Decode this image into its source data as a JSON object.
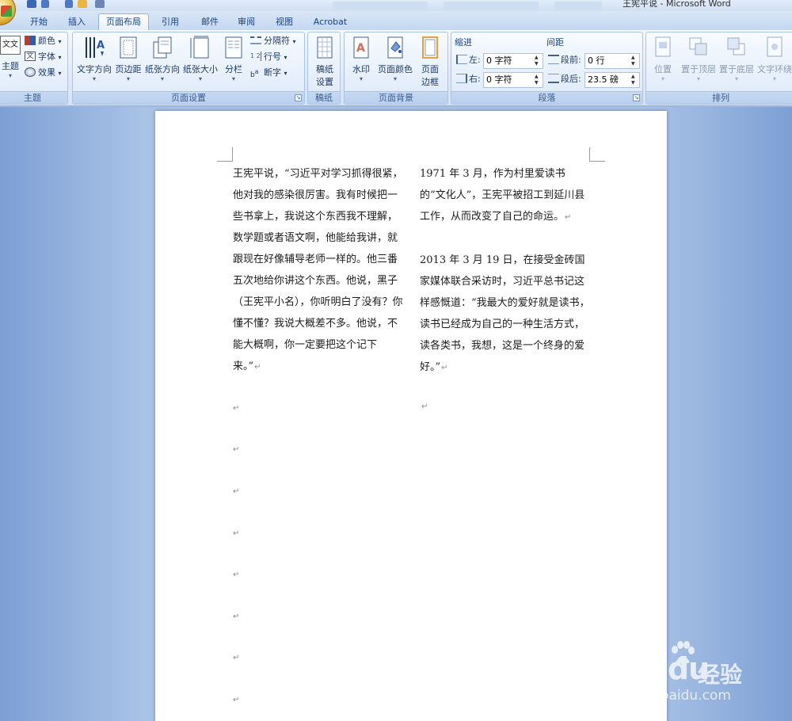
{
  "window": {
    "title": "王宪平说 - Microsoft Word"
  },
  "tabs": [
    {
      "label": "开始"
    },
    {
      "label": "插入"
    },
    {
      "label": "页面布局",
      "active": true
    },
    {
      "label": "引用"
    },
    {
      "label": "邮件"
    },
    {
      "label": "审阅"
    },
    {
      "label": "视图"
    },
    {
      "label": "Acrobat"
    }
  ],
  "ribbon": {
    "themes": {
      "label": "主题",
      "theme_button": "主题",
      "colors": "颜色",
      "fonts": "字体",
      "effects": "效果"
    },
    "page_setup": {
      "label": "页面设置",
      "text_direction": "文字方向",
      "margins": "页边距",
      "orientation": "纸张方向",
      "size": "纸张大小",
      "columns": "分栏",
      "breaks": "分隔符",
      "line_numbers": "行号",
      "hyphenation": "断字"
    },
    "manuscript": {
      "label": "稿纸",
      "settings_line1": "稿纸",
      "settings_line2": "设置"
    },
    "page_background": {
      "label": "页面背景",
      "watermark": "水印",
      "page_color": "页面颜色",
      "page_borders_line1": "页面",
      "page_borders_line2": "边框"
    },
    "paragraph": {
      "label": "段落",
      "indent_label": "缩进",
      "spacing_label": "间距",
      "left_label": "左:",
      "left_value": "0 字符",
      "right_label": "右:",
      "right_value": "0 字符",
      "before_label": "段前:",
      "before_value": "0 行",
      "after_label": "段后:",
      "after_value": "23.5 磅"
    },
    "arrange": {
      "label": "排列",
      "position": "位置",
      "bring_to_front": "置于顶层",
      "send_to_back": "置于底层",
      "text_wrapping": "文字环绕"
    }
  },
  "document": {
    "left_column": "王宪平说，“习近平对学习抓得很紧，他对我的感染很厉害。我有时候把一些书拿上，我说这个东西我不理解，数学题或者语文啊，他能给我讲，就跟现在好像辅导老师一样的。他三番五次地给你讲这个东西。他说，黑子（王宪平小名），你听明白了没有？你懂不懂？我说大概差不多。他说，不能大概啊，你一定要把这个记下来。”",
    "right_paragraphs": [
      "1971 年 3 月，作为村里爱读书的“文化人”，王宪平被招工到延川县工作，从而改变了自己的命运。",
      "2013 年 3 月 19 日，在接受金砖国家媒体联合采访时，习近平总书记这样感慨道：“我最大的爱好就是读书，读书已经成为自己的一种生活方式，读各类书，我想，这是一个终身的爱好。”"
    ],
    "paragraph_mark": "↵"
  },
  "watermark": {
    "brand": "Bai  du",
    "brand_cn": "经验",
    "url": "jingyan.baidu.com"
  },
  "colors": {
    "ribbon_accent": "#15428b",
    "doc_background": "#a9c3e6"
  }
}
